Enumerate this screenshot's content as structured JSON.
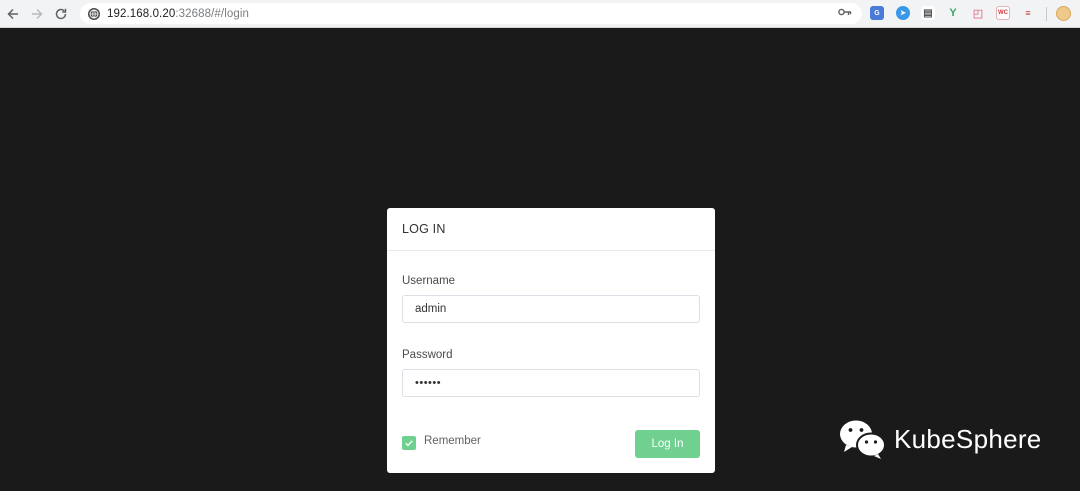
{
  "browser": {
    "url_host": "192.168.0.20",
    "url_rest": ":32688/#/login",
    "extensions": [
      {
        "name": "translate-extension-icon",
        "color": "#4a79d8",
        "glyph": "G"
      },
      {
        "name": "vpn-extension-icon",
        "color": "#3a98e8",
        "glyph": "●"
      },
      {
        "name": "reader-extension-icon",
        "color": "#555555",
        "glyph": "≡"
      },
      {
        "name": "leaf-extension-icon",
        "color": "#3da36a",
        "glyph": "Y"
      },
      {
        "name": "gift-extension-icon",
        "color": "#e58aa0",
        "glyph": "□"
      },
      {
        "name": "wc-extension-icon",
        "color": "#ffffff",
        "glyph": "WC"
      },
      {
        "name": "flag-extension-icon",
        "color": "#ffffff",
        "glyph": "⚑"
      }
    ]
  },
  "login": {
    "title": "LOG IN",
    "username_label": "Username",
    "username_value": "admin",
    "password_label": "Password",
    "password_value": "••••••",
    "remember_label": "Remember",
    "remember_checked": true,
    "submit_label": "Log In"
  },
  "watermark": {
    "text": "KubeSphere"
  },
  "colors": {
    "accent": "#6fd08f",
    "background": "#1a1a1a"
  }
}
